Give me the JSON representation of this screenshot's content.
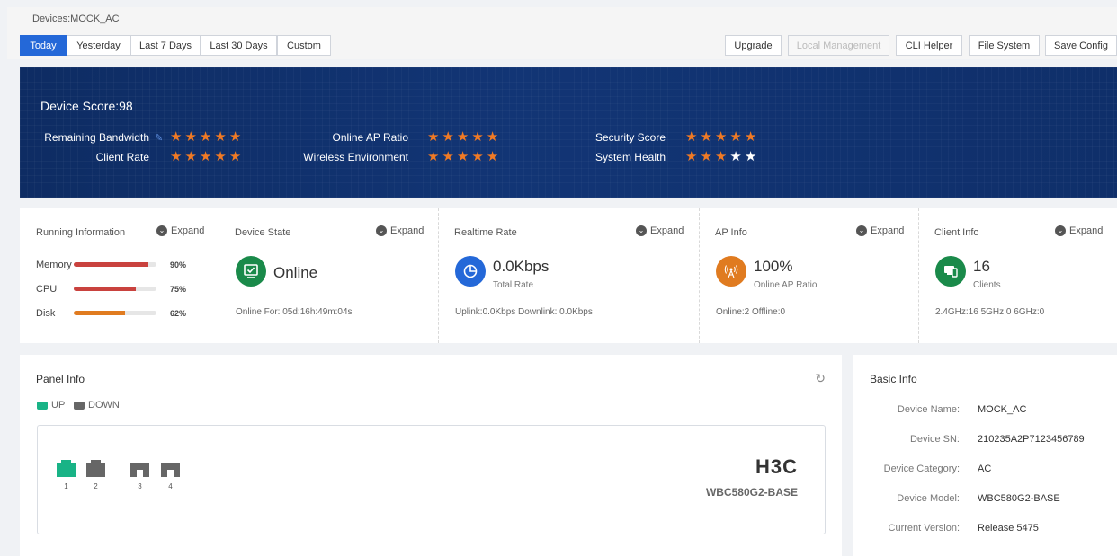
{
  "breadcrumb": "Devices:MOCK_AC",
  "date_tabs": [
    "Today",
    "Yesterday",
    "Last 7 Days",
    "Last 30 Days",
    "Custom"
  ],
  "actions": [
    "Upgrade",
    "Local Management",
    "CLI Helper",
    "File System",
    "Save Config"
  ],
  "banner": {
    "score": "Device Score:98",
    "ratings": [
      {
        "label": "Remaining Bandwidth",
        "stars": 5,
        "max": 5
      },
      {
        "label": "Client Rate",
        "stars": 5,
        "max": 5
      },
      {
        "label": "Online AP Ratio",
        "stars": 5,
        "max": 5
      },
      {
        "label": "Wireless Environment",
        "stars": 5,
        "max": 5
      },
      {
        "label": "Security Score",
        "stars": 5,
        "max": 5
      },
      {
        "label": "System Health",
        "stars": 3,
        "max": 5
      }
    ],
    "star_color": "#f07a25"
  },
  "expand_label": "Expand",
  "running": {
    "title": "Running Information",
    "items": [
      {
        "label": "Memory",
        "pct": "90%",
        "value": 90,
        "color": "#c9423e"
      },
      {
        "label": "CPU",
        "pct": "75%",
        "value": 75,
        "color": "#c9423e"
      },
      {
        "label": "Disk",
        "pct": "62%",
        "value": 62,
        "color": "#e07b20"
      }
    ]
  },
  "device_state": {
    "title": "Device State",
    "status": "Online",
    "footer": "Online For: 05d:16h:49m:04s",
    "color": "#1a8a4a"
  },
  "realtime": {
    "title": "Realtime Rate",
    "value": "0.0Kbps",
    "sub": "Total Rate",
    "footer": "Uplink:0.0Kbps  Downlink: 0.0Kbps",
    "color": "#2468d8"
  },
  "ap_info": {
    "title": "AP Info",
    "value": "100%",
    "sub": "Online AP Ratio",
    "footer": "Online:2  Offline:0",
    "color": "#e07b20"
  },
  "client_info": {
    "title": "Client Info",
    "value": "16",
    "sub": "Clients",
    "footer": "2.4GHz:16  5GHz:0  6GHz:0",
    "color": "#1a8a4a"
  },
  "panel": {
    "title": "Panel Info",
    "legend_up": "UP",
    "legend_down": "DOWN",
    "up_color": "#19b386",
    "down_color": "#666666",
    "ports": [
      {
        "num": "1",
        "status": "up"
      },
      {
        "num": "2",
        "status": "down"
      },
      {
        "num": "3",
        "status": "down"
      },
      {
        "num": "4",
        "status": "down"
      }
    ],
    "brand": "H3C",
    "model": "WBC580G2-BASE"
  },
  "basic_info": {
    "title": "Basic Info",
    "rows": [
      {
        "label": "Device Name:",
        "value": "MOCK_AC"
      },
      {
        "label": "Device SN:",
        "value": "210235A2P7123456789"
      },
      {
        "label": "Device Category:",
        "value": "AC"
      },
      {
        "label": "Device Model:",
        "value": "WBC580G2-BASE"
      },
      {
        "label": "Current Version:",
        "value": "Release 5475"
      }
    ]
  }
}
